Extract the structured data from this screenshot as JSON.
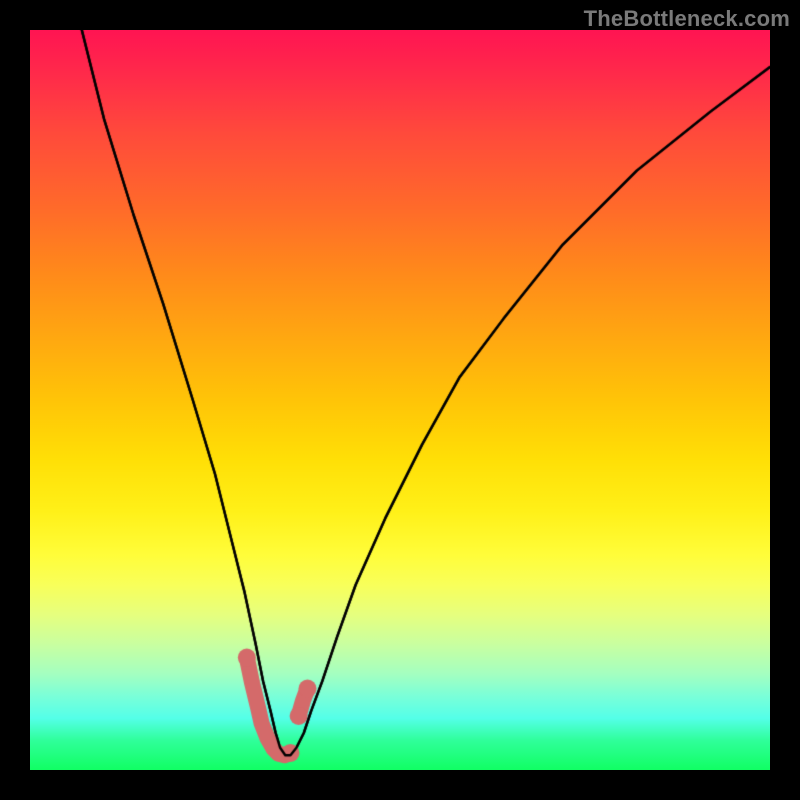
{
  "watermark": "TheBottleneck.com",
  "chart_data": {
    "type": "line",
    "title": "",
    "xlabel": "",
    "ylabel": "",
    "xlim": [
      0,
      100
    ],
    "ylim": [
      0,
      100
    ],
    "grid": false,
    "series": [
      {
        "name": "curve",
        "color": "#000000",
        "x": [
          7,
          10,
          14,
          18,
          22,
          25,
          27,
          29,
          30.5,
          31.5,
          32.5,
          33.2,
          33.8,
          34.5,
          35.2,
          36,
          37,
          38,
          39.5,
          41.5,
          44,
          48,
          53,
          58,
          64,
          72,
          82,
          92,
          100
        ],
        "y": [
          100,
          88,
          75,
          63,
          50,
          40,
          32,
          24,
          17,
          12,
          8,
          5,
          3,
          2,
          2,
          3,
          5,
          8,
          12,
          18,
          25,
          34,
          44,
          53,
          61,
          71,
          81,
          89,
          95
        ]
      }
    ],
    "markers": [
      {
        "name": "highlight-segment-left",
        "color": "#d46a6a",
        "x": [
          29.3,
          30.0,
          30.8,
          31.3,
          32.1,
          32.9,
          33.6,
          34.4,
          35.2
        ],
        "y": [
          15.2,
          11.8,
          8.5,
          6.3,
          4.3,
          2.9,
          2.2,
          2.0,
          2.3
        ]
      },
      {
        "name": "highlight-segment-right",
        "color": "#d46a6a",
        "x": [
          36.3,
          36.9,
          37.5
        ],
        "y": [
          7.3,
          9.4,
          11.0
        ]
      }
    ]
  }
}
